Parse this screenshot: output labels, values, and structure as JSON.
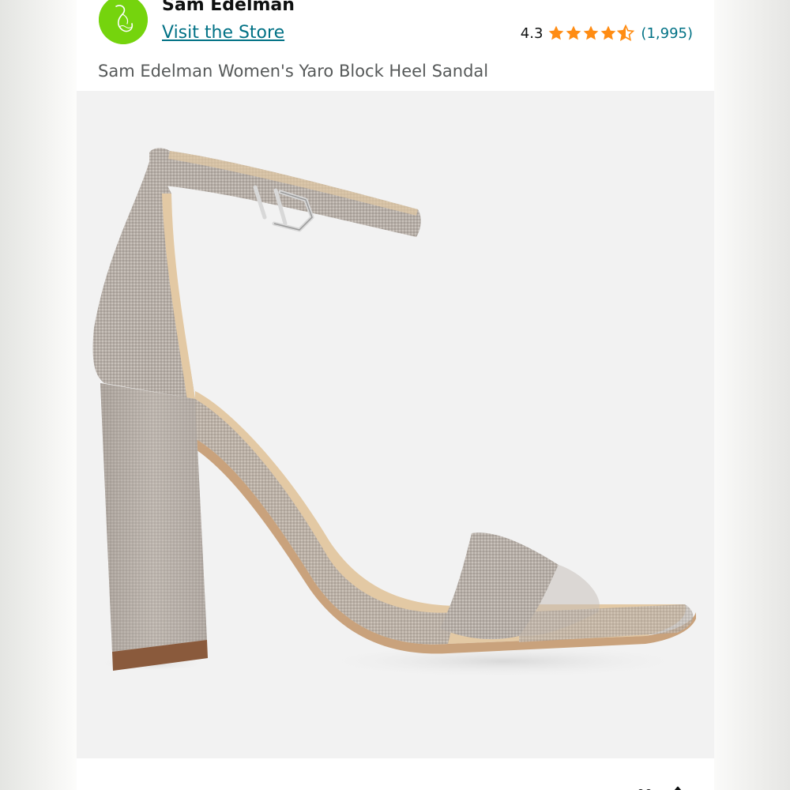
{
  "store": {
    "brand_name": "Sam Edelman",
    "store_link": "Visit the Store",
    "logo_icon": "sam-edelman-logo",
    "logo_color": "#75d40d"
  },
  "rating": {
    "value": "4.3",
    "stars": 4.3,
    "max_stars": 5,
    "star_color": "#ff8c13",
    "count": "(1,995)"
  },
  "product": {
    "title": "Sam Edelman Women's Yaro Block Heel Sandal",
    "image_icon": "sandal-product-image"
  },
  "colors": {
    "link": "#007185",
    "text": "#0f1111",
    "muted": "#565959"
  }
}
